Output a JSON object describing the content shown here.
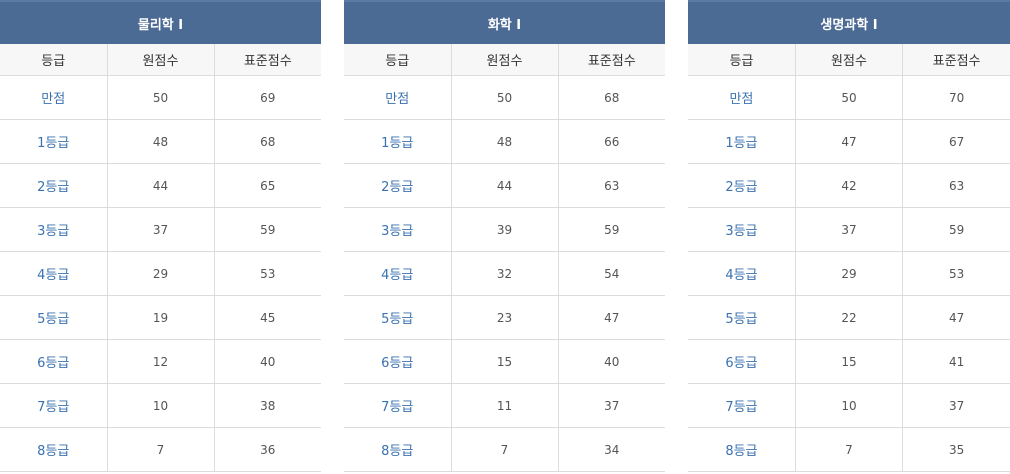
{
  "panels": [
    {
      "title": "물리학 I",
      "headers": [
        "등급",
        "원점수",
        "표준점수"
      ],
      "rows": [
        [
          "만점",
          "50",
          "69"
        ],
        [
          "1등급",
          "48",
          "68"
        ],
        [
          "2등급",
          "44",
          "65"
        ],
        [
          "3등급",
          "37",
          "59"
        ],
        [
          "4등급",
          "29",
          "53"
        ],
        [
          "5등급",
          "19",
          "45"
        ],
        [
          "6등급",
          "12",
          "40"
        ],
        [
          "7등급",
          "10",
          "38"
        ],
        [
          "8등급",
          "7",
          "36"
        ]
      ]
    },
    {
      "title": "화학 I",
      "headers": [
        "등급",
        "원점수",
        "표준점수"
      ],
      "rows": [
        [
          "만점",
          "50",
          "68"
        ],
        [
          "1등급",
          "48",
          "66"
        ],
        [
          "2등급",
          "44",
          "63"
        ],
        [
          "3등급",
          "39",
          "59"
        ],
        [
          "4등급",
          "32",
          "54"
        ],
        [
          "5등급",
          "23",
          "47"
        ],
        [
          "6등급",
          "15",
          "40"
        ],
        [
          "7등급",
          "11",
          "37"
        ],
        [
          "8등급",
          "7",
          "34"
        ]
      ]
    },
    {
      "title": "생명과학 I",
      "headers": [
        "등급",
        "원점수",
        "표준점수"
      ],
      "rows": [
        [
          "만점",
          "50",
          "70"
        ],
        [
          "1등급",
          "47",
          "67"
        ],
        [
          "2등급",
          "42",
          "63"
        ],
        [
          "3등급",
          "37",
          "59"
        ],
        [
          "4등급",
          "29",
          "53"
        ],
        [
          "5등급",
          "22",
          "47"
        ],
        [
          "6등급",
          "15",
          "41"
        ],
        [
          "7등급",
          "10",
          "37"
        ],
        [
          "8등급",
          "7",
          "35"
        ]
      ]
    }
  ]
}
